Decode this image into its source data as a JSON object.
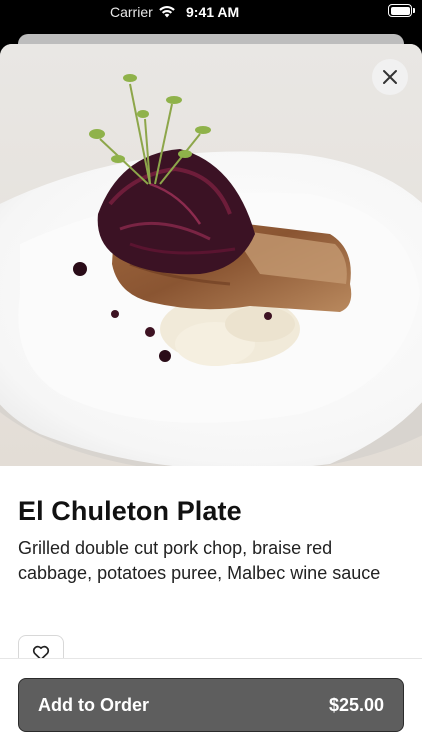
{
  "status_bar": {
    "carrier": "Carrier",
    "time": "9:41 AM"
  },
  "item": {
    "name": "El Chuleton Plate",
    "description": "Grilled double cut pork chop, braise red cabbage, potatoes puree, Malbec wine sauce"
  },
  "actions": {
    "add_label": "Add to Order",
    "price": "$25.00"
  },
  "icons": {
    "close": "close-icon",
    "favorite": "heart-outline-icon",
    "wifi": "wifi-icon",
    "battery": "battery-icon"
  },
  "colors": {
    "button_bg": "#5e5e5e",
    "button_text": "#ffffff",
    "title": "#111111"
  }
}
